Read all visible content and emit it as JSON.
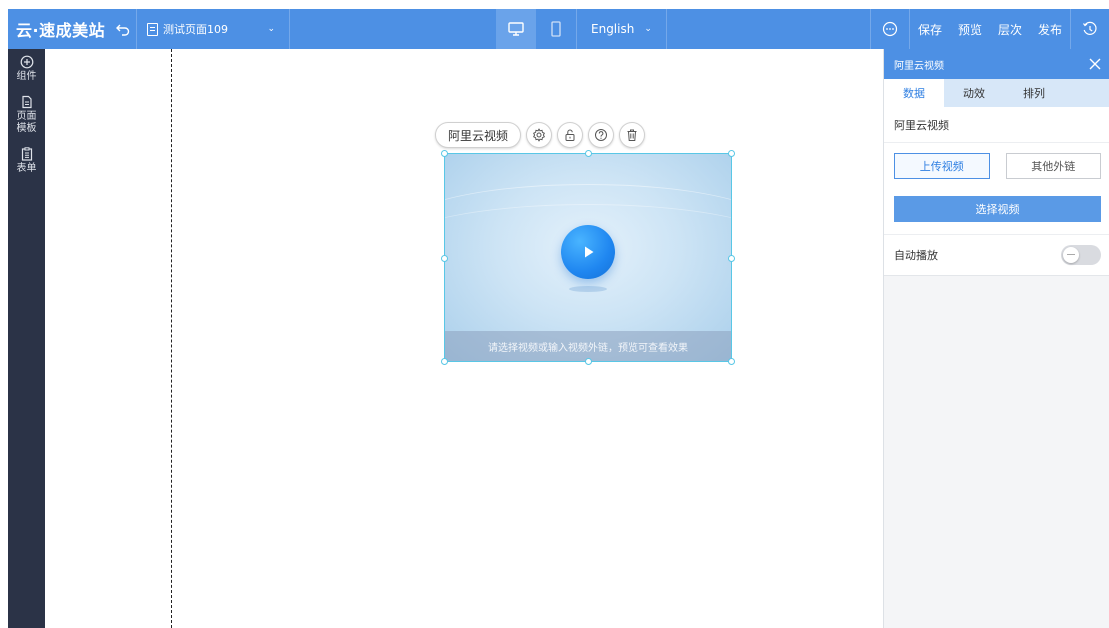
{
  "topbar": {
    "brand": "云·速成美站",
    "page_name": "测试页面109",
    "language": "English",
    "save": "保存",
    "preview": "预览",
    "layers": "层次",
    "publish": "发布"
  },
  "sidebar": {
    "items": [
      {
        "label": "组件",
        "icon": "plus-circle-icon"
      },
      {
        "label": "页面\n模板",
        "icon": "document-icon"
      },
      {
        "label": "表单",
        "icon": "clipboard-icon"
      }
    ]
  },
  "canvas": {
    "component_name": "阿里云视频",
    "video_caption": "请选择视频或输入视频外链，预览可查看效果"
  },
  "panel": {
    "title": "阿里云视频",
    "tabs": [
      "数据",
      "动效",
      "排列"
    ],
    "active_tab": "数据",
    "section_title": "阿里云视频",
    "upload_button": "上传视频",
    "external_link_button": "其他外链",
    "select_button": "选择视频",
    "autoplay_label": "自动播放",
    "autoplay_on": false
  },
  "colors": {
    "accent": "#4d90e4",
    "sidebar": "#2b3347",
    "selection": "#59c7e6"
  }
}
